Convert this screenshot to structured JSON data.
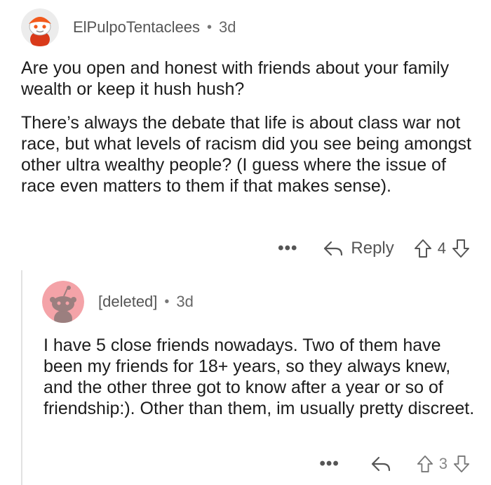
{
  "comments": [
    {
      "username": "ElPulpoTentaclees",
      "separator": "•",
      "age": "3d",
      "paragraphs": [
        "Are you open and honest with friends about your family wealth or keep it hush hush?",
        "There’s always the debate that life is about class war not race, but what levels of racism did you see being amongst other ultra wealthy people? (I guess where the issue of race even matters to them if that makes sense)."
      ],
      "more_label": "•••",
      "reply_label": "Reply",
      "score": "4"
    },
    {
      "username": "[deleted]",
      "separator": "•",
      "age": "3d",
      "paragraphs": [
        "I have 5 close friends nowadays. Two of them have been my friends for 18+ years, so they always knew, and the other three got to know after a year or so of friendship:). Other than them, im usually pretty discreet."
      ],
      "more_label": "•••",
      "score": "3"
    }
  ],
  "colors": {
    "avatar_deleted_bg": "#f4a3a8",
    "avatar_user_bg": "#e8e8e8",
    "accent_orange": "#f25a1d"
  },
  "icons": [
    "snoo-avatar-icon",
    "deleted-avatar-icon",
    "reply-arrow-icon",
    "upvote-icon",
    "downvote-icon"
  ]
}
